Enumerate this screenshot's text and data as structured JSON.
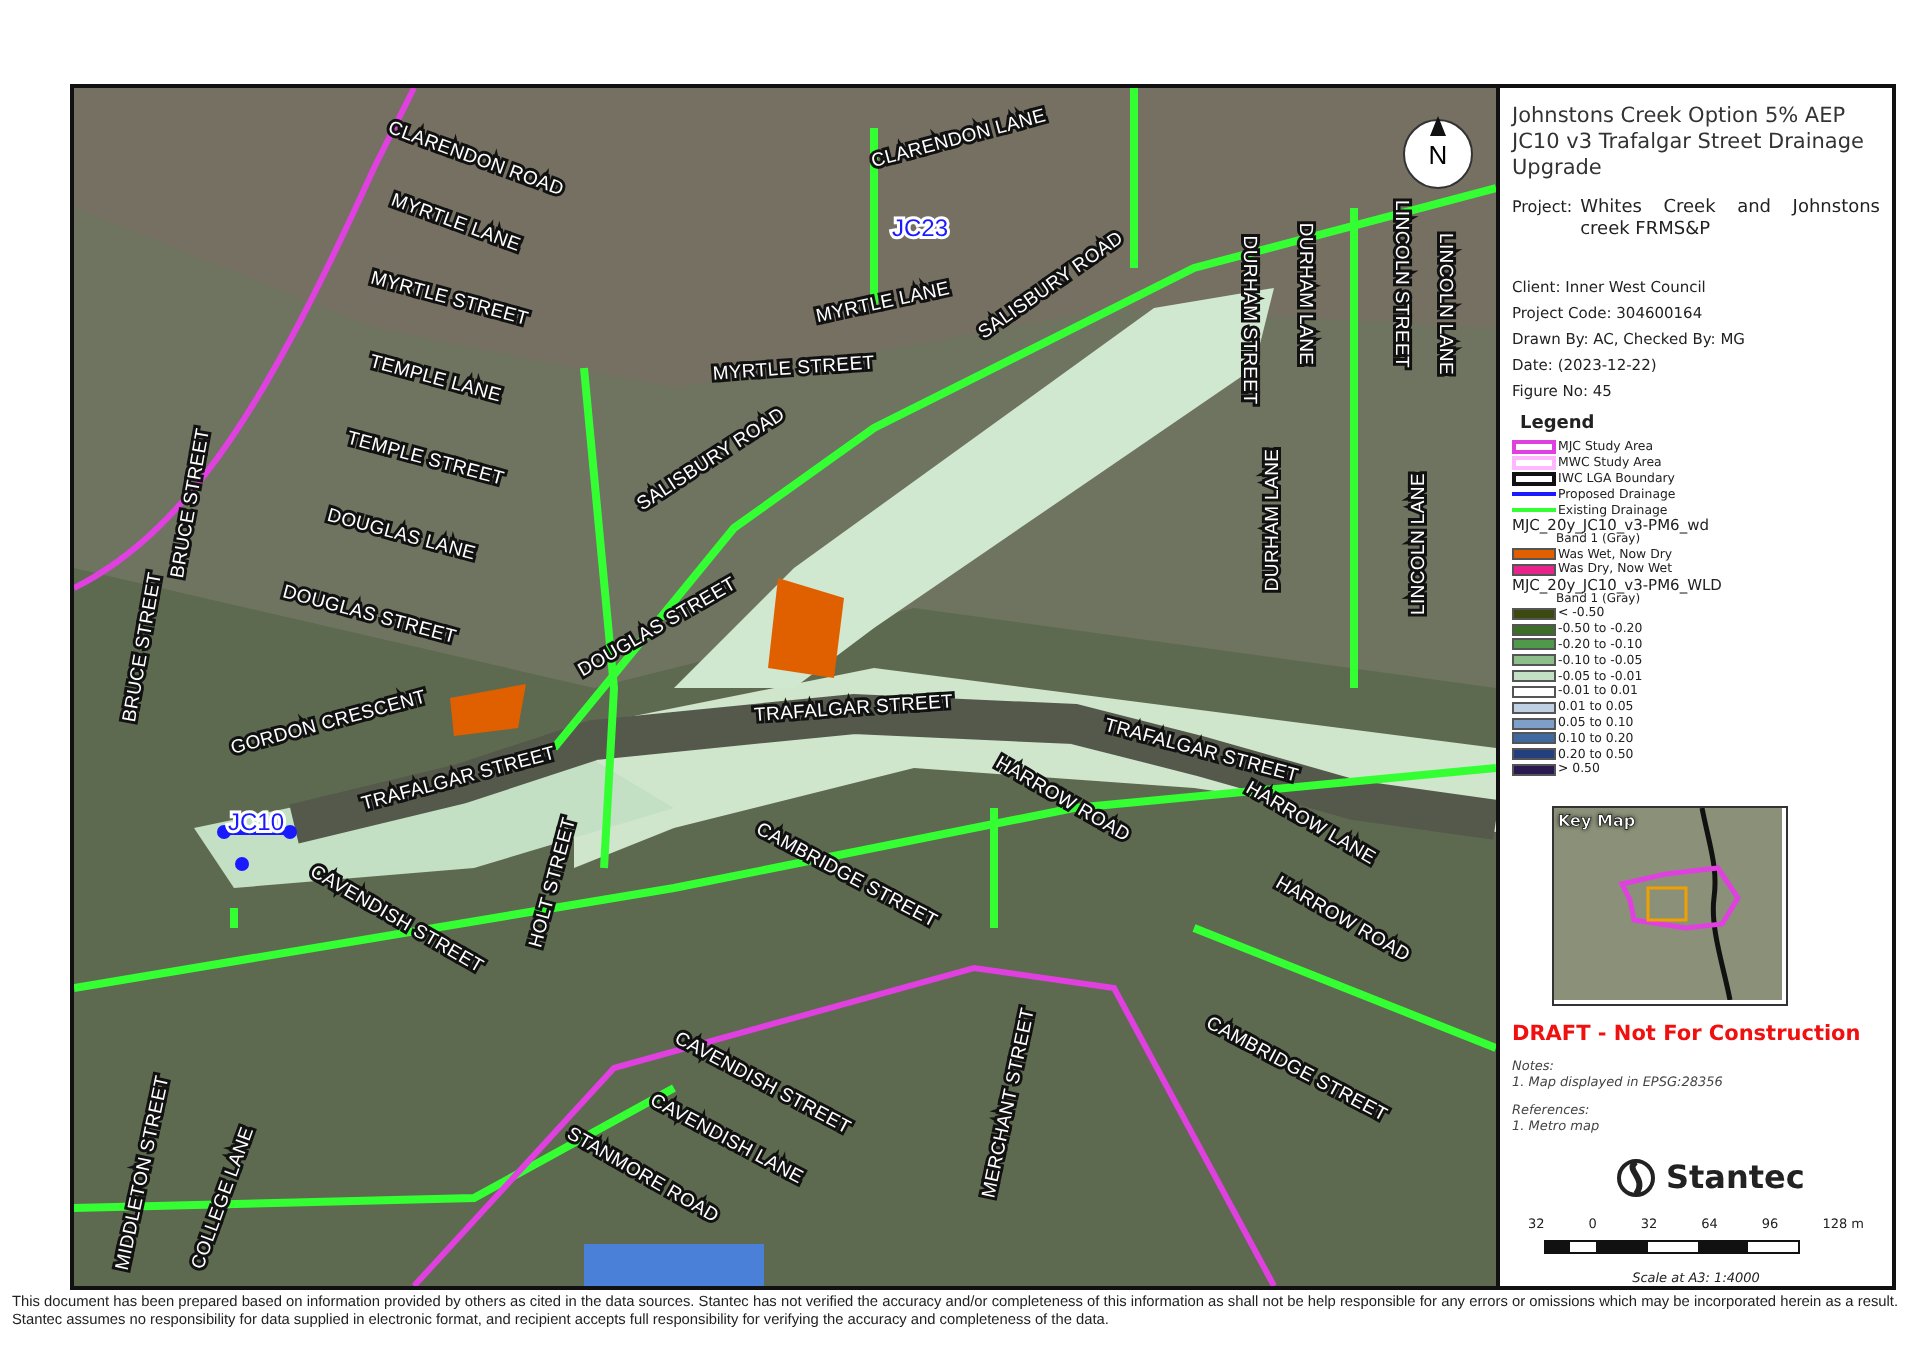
{
  "map": {
    "north_label": "N",
    "nodes": [
      {
        "label": "JC23"
      },
      {
        "label": "JC10"
      }
    ],
    "street_labels": [
      {
        "label": "CLARENDON ROAD"
      },
      {
        "label": "CLARENDON LANE"
      },
      {
        "label": "MYRTLE LANE"
      },
      {
        "label": "MYRTLE STREET"
      },
      {
        "label": "MYRTLE LANE"
      },
      {
        "label": "TEMPLE LANE"
      },
      {
        "label": "MYRTLE STREET"
      },
      {
        "label": "SALISBURY ROAD"
      },
      {
        "label": "TEMPLE STREET"
      },
      {
        "label": "SALISBURY ROAD"
      },
      {
        "label": "DURHAM STREET"
      },
      {
        "label": "DURHAM LANE"
      },
      {
        "label": "LINCOLN STREET"
      },
      {
        "label": "LINCOLN LANE"
      },
      {
        "label": "DOUGLAS LANE"
      },
      {
        "label": "DURHAM LANE"
      },
      {
        "label": "LINCOLN LANE"
      },
      {
        "label": "BRUCE STREET"
      },
      {
        "label": "BRUCE STREET"
      },
      {
        "label": "DOUGLAS STREET"
      },
      {
        "label": "DOUGLAS STREET"
      },
      {
        "label": "GORDON CRESCENT"
      },
      {
        "label": "TRAFALGAR STREET"
      },
      {
        "label": "TRAFALGAR STREET"
      },
      {
        "label": "TRAFALGAR STREET"
      },
      {
        "label": "HARROW ROAD"
      },
      {
        "label": "HARROW LANE"
      },
      {
        "label": "HOLT STREET"
      },
      {
        "label": "CAMBRIDGE STREET"
      },
      {
        "label": "HARROW ROAD"
      },
      {
        "label": "CAVENDISH STREET"
      },
      {
        "label": "CAVENDISH STREET"
      },
      {
        "label": "CAVENDISH LANE"
      },
      {
        "label": "MERCHANT STREET"
      },
      {
        "label": "CAMBRIDGE STREET"
      },
      {
        "label": "MIDDLETON STREET"
      },
      {
        "label": "COLLEGE LANE"
      },
      {
        "label": "STANMORE ROAD"
      }
    ]
  },
  "panel": {
    "title": "Johnstons Creek Option 5% AEP JC10 v3 Trafalgar Street Drainage Upgrade",
    "project_label": "Project:",
    "project": "Whites Creek and Johnstons creek FRMS&P",
    "details": [
      "Client:  Inner West Council",
      "Project Code:  304600164",
      "Drawn By:  AC, Checked By: MG",
      "Date:  (2023-12-22)",
      "Figure No:  45"
    ],
    "legend": {
      "title": "Legend",
      "symbols": [
        {
          "kind": "outline",
          "label": "MJC Study Area",
          "color": "#e040e0"
        },
        {
          "kind": "outline",
          "label": "MWC Study Area",
          "color": "#ffb8ff"
        },
        {
          "kind": "outline",
          "label": "IWC LGA Boundary",
          "color": "#111111"
        },
        {
          "kind": "line",
          "label": "Proposed Drainage",
          "color": "#1a1aff"
        },
        {
          "kind": "line",
          "label": "Existing Drainage",
          "color": "#33ff33"
        }
      ],
      "layers": [
        {
          "title": "MJC_20y_JC10_v3-PM6_wd",
          "band": "Band 1 (Gray)",
          "classes": [
            {
              "label": "Was Wet, Now Dry",
              "color": "#e06000"
            },
            {
              "label": "Was Dry, Now Wet",
              "color": "#e8248c"
            }
          ]
        },
        {
          "title": "MJC_20y_JC10_v3-PM6_WLD",
          "band": "Band 1 (Gray)",
          "classes": [
            {
              "label": "< -0.50",
              "color": "#3a4a10"
            },
            {
              "label": "-0.50 to -0.20",
              "color": "#3c6e2a"
            },
            {
              "label": "-0.20 to -0.10",
              "color": "#4e9a4a"
            },
            {
              "label": "-0.10 to -0.05",
              "color": "#8ebf8a"
            },
            {
              "label": "-0.05 to -0.01",
              "color": "#c4e0c4"
            },
            {
              "label": "-0.01 to 0.01",
              "color": "#ffffff"
            },
            {
              "label": "0.01 to 0.05",
              "color": "#c0d0e4"
            },
            {
              "label": "0.05 to 0.10",
              "color": "#7ea0c8"
            },
            {
              "label": "0.10 to 0.20",
              "color": "#3e6aa0"
            },
            {
              "label": "0.20 to 0.50",
              "color": "#243f80"
            },
            {
              "label": "> 0.50",
              "color": "#2a1a50"
            }
          ]
        }
      ]
    },
    "key_map_label": "Key Map",
    "draft": "DRAFT - Not For Construction",
    "notes_title": "Notes:",
    "notes": [
      "1. Map displayed in EPSG:28356"
    ],
    "references_title": "References:",
    "references": [
      "1. Metro map"
    ],
    "logo_text": "Stantec",
    "scale_ticks": [
      "32",
      "0",
      "32",
      "64",
      "96",
      "128 m"
    ],
    "scale_text": "Scale at A3: 1:4000"
  },
  "disclaimer": "This document has been prepared based on information provided by others as cited in the data sources. Stantec has not verified the accuracy and/or completeness of this information as shall not be help responsible for any errors or omissions which may be incorporated herein as a result. Stantec assumes no responsibility for data supplied in electronic format, and recipient accepts full responsibility for verifying the accuracy and completeness of the data."
}
